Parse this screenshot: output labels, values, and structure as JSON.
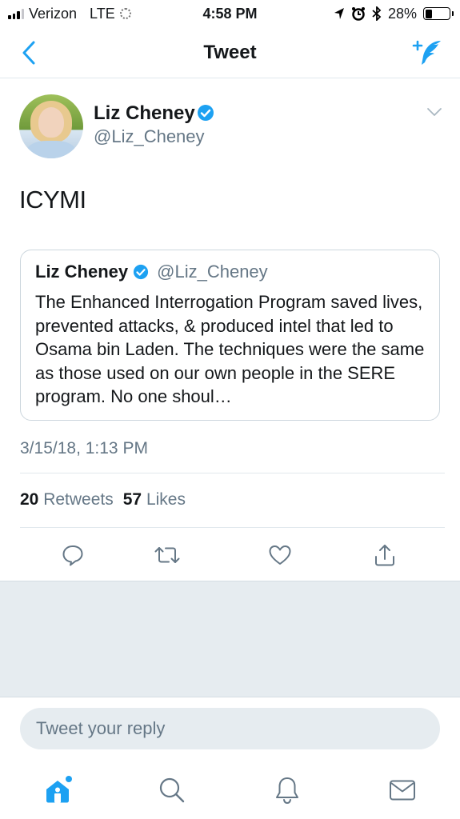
{
  "status_bar": {
    "carrier": "Verizon",
    "network": "LTE",
    "time": "4:58 PM",
    "battery": "28%",
    "battery_level": 0.28
  },
  "nav": {
    "title": "Tweet",
    "back_icon": "chevron-left-icon",
    "compose_icon": "compose-tweet-icon"
  },
  "tweet": {
    "author_name": "Liz Cheney",
    "author_handle": "@Liz_Cheney",
    "text": "ICYMI",
    "timestamp": "3/15/18, 1:13 PM",
    "retweets_count": "20",
    "retweets_label": "Retweets",
    "likes_count": "57",
    "likes_label": "Likes"
  },
  "quoted_tweet": {
    "author_name": "Liz Cheney",
    "author_handle": "@Liz_Cheney",
    "text": "The Enhanced Interrogation Program saved lives, prevented attacks, & produced intel that led to Osama bin Laden. The techniques were the same as those used on our own people in the SERE program. No one shoul…"
  },
  "actions": [
    "reply-icon",
    "retweet-icon",
    "like-icon",
    "share-icon"
  ],
  "reply": {
    "placeholder": "Tweet your reply"
  },
  "tabs": [
    "home-icon",
    "search-icon",
    "notifications-icon",
    "messages-icon"
  ],
  "colors": {
    "accent": "#1da1f2",
    "icon_gray": "#657786",
    "divider": "#e1e8ed",
    "empty_bg": "#e6ecf0"
  }
}
